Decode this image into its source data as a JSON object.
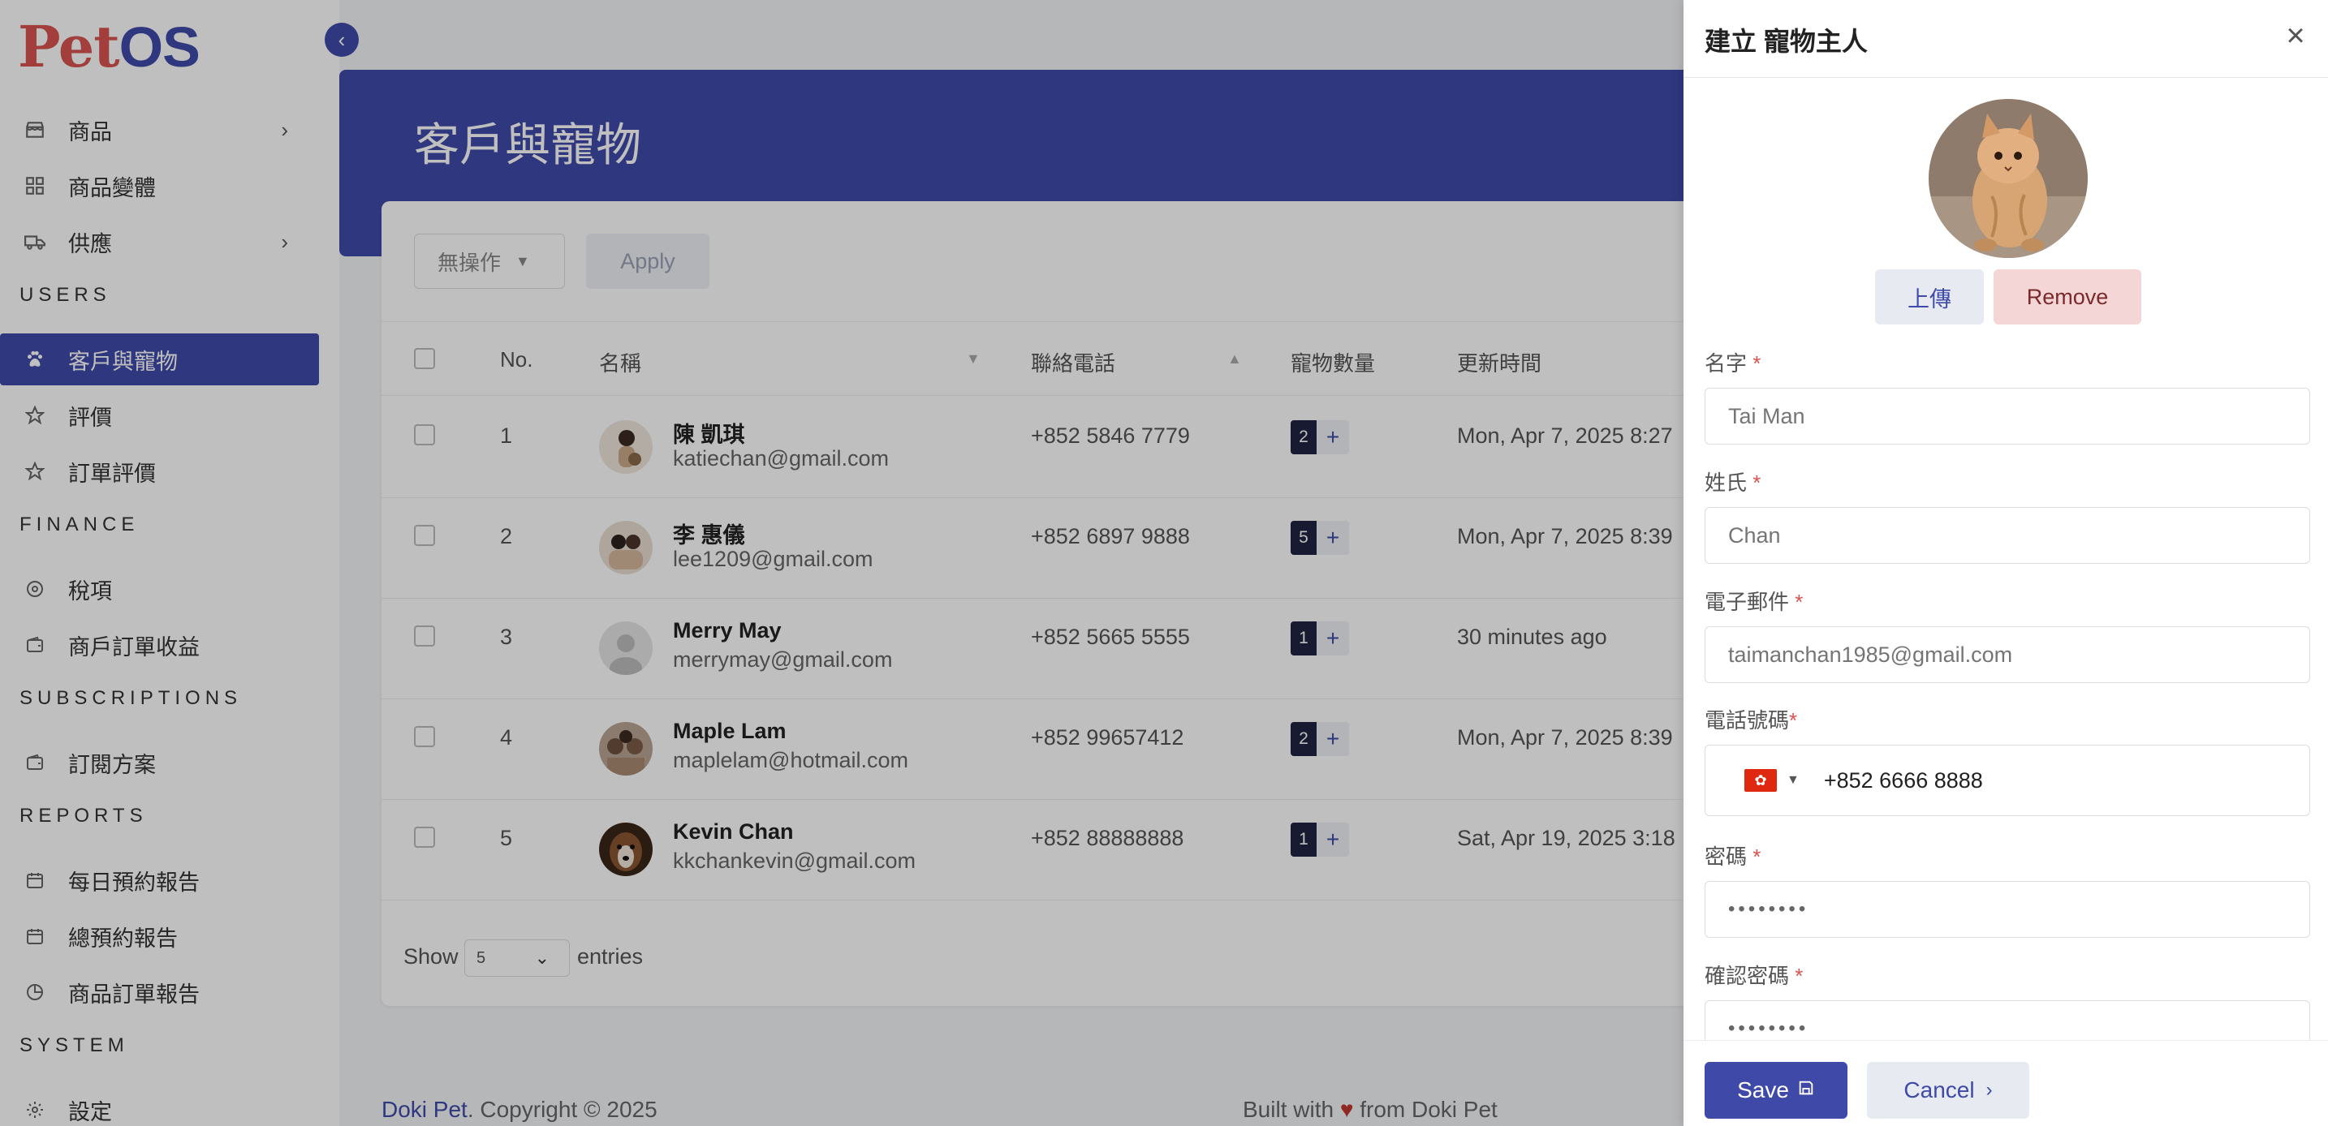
{
  "brand": {
    "logo_p": "P",
    "logo_et": "et",
    "logo_os": "OS"
  },
  "sidebar": {
    "items": [
      {
        "label": "商品",
        "icon": "shop-icon",
        "has_children": true
      },
      {
        "label": "商品變體",
        "icon": "variant-icon",
        "has_children": false
      },
      {
        "label": "供應",
        "icon": "truck-icon",
        "has_children": true
      }
    ],
    "sections": [
      {
        "title": "USERS",
        "items": [
          {
            "label": "客戶與寵物",
            "icon": "paw-icon",
            "active": true
          },
          {
            "label": "評價",
            "icon": "star-icon"
          },
          {
            "label": "訂單評價",
            "icon": "star-icon"
          }
        ]
      },
      {
        "title": "FINANCE",
        "items": [
          {
            "label": "稅項",
            "icon": "tax-icon"
          },
          {
            "label": "商戶訂單收益",
            "icon": "wallet-icon"
          }
        ]
      },
      {
        "title": "SUBSCRIPTIONS",
        "items": [
          {
            "label": "訂閱方案",
            "icon": "wallet-icon"
          }
        ]
      },
      {
        "title": "REPORTS",
        "items": [
          {
            "label": "每日預約報告",
            "icon": "calendar-icon"
          },
          {
            "label": "總預約報告",
            "icon": "calendar-icon"
          },
          {
            "label": "商品訂單報告",
            "icon": "chart-icon"
          }
        ]
      },
      {
        "title": "SYSTEM",
        "items": [
          {
            "label": "設定",
            "icon": "gear-icon"
          }
        ]
      }
    ]
  },
  "page": {
    "title": "客戶與寵物"
  },
  "toolbar": {
    "bulk_action": "無操作",
    "apply_label": "Apply"
  },
  "table": {
    "headers": {
      "no": "No.",
      "name": "名稱",
      "phone": "聯絡電話",
      "pets": "寵物數量",
      "updated": "更新時間"
    },
    "rows": [
      {
        "no": "1",
        "name": "陳 凱琪",
        "email": "katiechan@gmail.com",
        "phone": "+852 5846 7779",
        "pets": "2",
        "updated": "Mon, Apr 7, 2025 8:27"
      },
      {
        "no": "2",
        "name": "李 惠儀",
        "email": "lee1209@gmail.com",
        "phone": "+852 6897 9888",
        "pets": "5",
        "updated": "Mon, Apr 7, 2025 8:39"
      },
      {
        "no": "3",
        "name": "Merry May",
        "email": "merrymay@gmail.com",
        "phone": "+852 5665 5555",
        "pets": "1",
        "updated": "30 minutes ago"
      },
      {
        "no": "4",
        "name": "Maple Lam",
        "email": "maplelam@hotmail.com",
        "phone": "+852 99657412",
        "pets": "2",
        "updated": "Mon, Apr 7, 2025 8:39"
      },
      {
        "no": "5",
        "name": "Kevin Chan",
        "email": "kkchankevin@gmail.com",
        "phone": "+852 88888888",
        "pets": "1",
        "updated": "Sat, Apr 19, 2025 3:18"
      }
    ]
  },
  "pagination": {
    "show_label": "Show",
    "page_size": "5",
    "entries_label": "entries"
  },
  "footer": {
    "brand": "Doki Pet",
    "copyright": ". Copyright © 2025",
    "built_prefix": "Built with",
    "built_suffix": "from Doki Pet"
  },
  "drawer": {
    "title": "建立 寵物主人",
    "upload_label": "上傳",
    "remove_label": "Remove",
    "fields": {
      "first_name": {
        "label": "名字",
        "placeholder": "Tai Man"
      },
      "last_name": {
        "label": "姓氏",
        "placeholder": "Chan"
      },
      "email": {
        "label": "電子郵件",
        "placeholder": "taimanchan1985@gmail.com"
      },
      "phone": {
        "label": "電話號碼",
        "value": "+852 6666 8888"
      },
      "password": {
        "label": "密碼",
        "value": "••••••••"
      },
      "confirm_password": {
        "label": "確認密碼",
        "value": "••••••••"
      }
    },
    "save_label": "Save",
    "cancel_label": "Cancel"
  },
  "colors": {
    "primary": "#3f4aa8",
    "danger": "#d9534f",
    "remove_bg": "#f4d6d6"
  }
}
